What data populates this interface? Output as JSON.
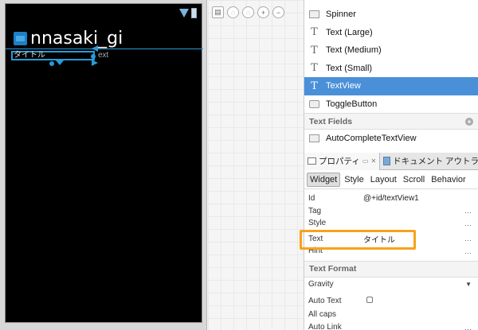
{
  "device": {
    "app_title": "nnasaki_gi",
    "selected_textview_text": "タイトル",
    "side_label": "ext"
  },
  "icons": {
    "signal": "signal-triangle-icon",
    "battery": "battery-icon",
    "app": "app-launcher-icon"
  },
  "palette": {
    "items": [
      {
        "label": "Spinner",
        "icon": "spinner-icon"
      },
      {
        "label": "Text (Large)",
        "icon": "text-large-icon"
      },
      {
        "label": "Text (Medium)",
        "icon": "text-medium-icon"
      },
      {
        "label": "Text (Small)",
        "icon": "text-small-icon"
      },
      {
        "label": "TextView",
        "icon": "textview-icon",
        "selected": true
      },
      {
        "label": "ToggleButton",
        "icon": "togglebutton-icon"
      }
    ],
    "section_text_fields": "Text Fields",
    "text_fields_items": [
      {
        "label": "AutoCompleteTextView",
        "icon": "autocomplete-icon"
      }
    ]
  },
  "properties": {
    "tab_properties": "プロパティ",
    "tab_outline": "ドキュメント アウトライン",
    "subtabs": [
      "Widget",
      "Style",
      "Layout",
      "Scroll",
      "Behavior"
    ],
    "rows": [
      {
        "name": "Id",
        "value": "@+id/textView1"
      },
      {
        "name": "Tag",
        "value": ""
      },
      {
        "name": "Style",
        "value": ""
      },
      {
        "name": "Text",
        "value": "タイトル"
      },
      {
        "name": "Hint",
        "value": ""
      }
    ],
    "section_text_format": "Text Format",
    "format_rows": [
      {
        "name": "Gravity",
        "value": ""
      },
      {
        "name": "Auto Text",
        "value": ""
      },
      {
        "name": "All caps",
        "value": ""
      },
      {
        "name": "Auto Link",
        "value": ""
      }
    ]
  },
  "colors": {
    "selection_blue": "#4a90d9",
    "highlight_orange": "#f7a21b",
    "screen_bg": "#000000"
  }
}
